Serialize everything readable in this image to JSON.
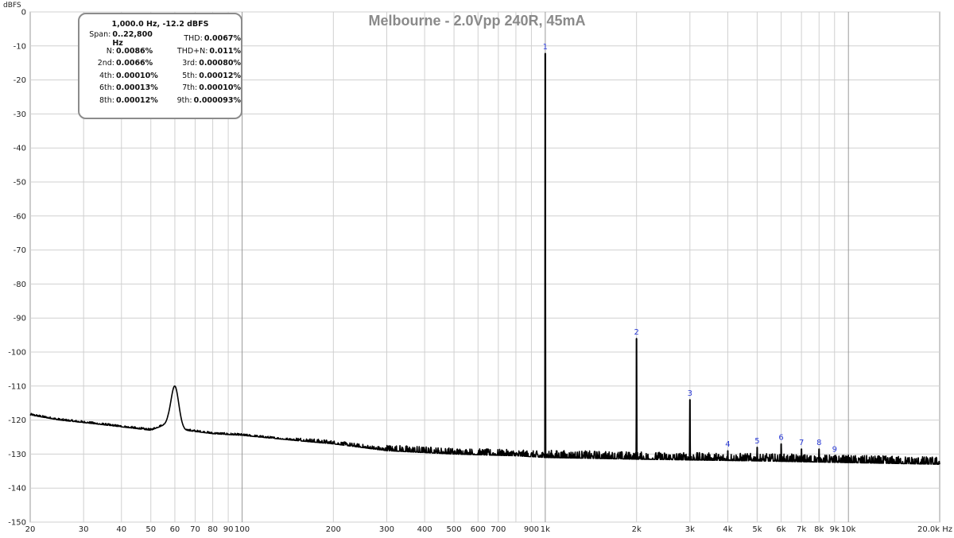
{
  "chart_data": {
    "type": "line",
    "title": "Melbourne - 2.0Vpp 240R, 45mA",
    "ylabel": "dBFS",
    "xlabel": "Hz",
    "xscale": "log",
    "xlim": [
      20,
      20000
    ],
    "ylim": [
      -150,
      0
    ],
    "grid": true,
    "legend": "none",
    "y_ticks": [
      "0",
      "-10",
      "-20",
      "-30",
      "-40",
      "-50",
      "-60",
      "-70",
      "-80",
      "-90",
      "-100",
      "-110",
      "-120",
      "-130",
      "-140",
      "-150"
    ],
    "x_ticks": [
      {
        "x": 20,
        "label": "20"
      },
      {
        "x": 30,
        "label": "30"
      },
      {
        "x": 40,
        "label": "40"
      },
      {
        "x": 50,
        "label": "50"
      },
      {
        "x": 60,
        "label": "60"
      },
      {
        "x": 70,
        "label": "70"
      },
      {
        "x": 80,
        "label": "80"
      },
      {
        "x": 90,
        "label": "90"
      },
      {
        "x": 100,
        "label": "100"
      },
      {
        "x": 200,
        "label": "200"
      },
      {
        "x": 300,
        "label": "300"
      },
      {
        "x": 400,
        "label": "400"
      },
      {
        "x": 500,
        "label": "500"
      },
      {
        "x": 600,
        "label": "600"
      },
      {
        "x": 700,
        "label": "700"
      },
      {
        "x": 900,
        "label": "900"
      },
      {
        "x": 1000,
        "label": "1k"
      },
      {
        "x": 2000,
        "label": "2k"
      },
      {
        "x": 3000,
        "label": "3k"
      },
      {
        "x": 4000,
        "label": "4k"
      },
      {
        "x": 5000,
        "label": "5k"
      },
      {
        "x": 6000,
        "label": "6k"
      },
      {
        "x": 7000,
        "label": "7k"
      },
      {
        "x": 8000,
        "label": "8k"
      },
      {
        "x": 9000,
        "label": "9k"
      },
      {
        "x": 10000,
        "label": "10k"
      },
      {
        "x": 20000,
        "label": "20.0k Hz"
      }
    ],
    "x_minor_grid": [
      30,
      40,
      50,
      60,
      70,
      80,
      90,
      200,
      300,
      400,
      500,
      600,
      700,
      800,
      900,
      2000,
      3000,
      4000,
      5000,
      6000,
      7000,
      8000,
      9000
    ],
    "x_major_grid": [
      100,
      1000,
      10000
    ],
    "series": [
      {
        "color": "#000000",
        "noise_floor": [
          [
            20,
            -118.5
          ],
          [
            25,
            -120
          ],
          [
            32,
            -121
          ],
          [
            40,
            -122
          ],
          [
            50,
            -123
          ],
          [
            57,
            -121
          ],
          [
            65,
            -123
          ],
          [
            80,
            -124
          ],
          [
            100,
            -124.5
          ],
          [
            150,
            -126
          ],
          [
            200,
            -127
          ],
          [
            300,
            -129
          ],
          [
            500,
            -130
          ],
          [
            800,
            -130.5
          ],
          [
            1000,
            -131
          ],
          [
            2000,
            -131.5
          ],
          [
            5000,
            -132
          ],
          [
            10000,
            -132.5
          ],
          [
            20000,
            -133
          ]
        ],
        "peaks": [
          {
            "x": 60,
            "y": -110,
            "kind": "hum"
          },
          {
            "x": 1000,
            "y": -12.2,
            "kind": "fundamental"
          },
          {
            "x": 2000,
            "y": -96,
            "kind": "harmonic"
          },
          {
            "x": 3000,
            "y": -114,
            "kind": "harmonic"
          },
          {
            "x": 4000,
            "y": -129,
            "kind": "harmonic"
          },
          {
            "x": 5000,
            "y": -128,
            "kind": "harmonic"
          },
          {
            "x": 6000,
            "y": -127,
            "kind": "harmonic"
          },
          {
            "x": 7000,
            "y": -128.5,
            "kind": "harmonic"
          },
          {
            "x": 8000,
            "y": -128.5,
            "kind": "harmonic"
          },
          {
            "x": 9000,
            "y": -130.5,
            "kind": "harmonic"
          }
        ]
      }
    ],
    "annotations": [
      {
        "label": "1",
        "x": 1000,
        "y": -12.2
      },
      {
        "label": "2",
        "x": 2000,
        "y": -96
      },
      {
        "label": "3",
        "x": 3000,
        "y": -114
      },
      {
        "label": "4",
        "x": 4000,
        "y": -129
      },
      {
        "label": "5",
        "x": 5000,
        "y": -128
      },
      {
        "label": "6",
        "x": 6000,
        "y": -127
      },
      {
        "label": "7",
        "x": 7000,
        "y": -128.5
      },
      {
        "label": "8",
        "x": 8000,
        "y": -128.5
      },
      {
        "label": "9",
        "x": 9000,
        "y": -130.5
      }
    ]
  },
  "info_box": {
    "header": "1,000.0 Hz, -12.2 dBFS",
    "rows": [
      {
        "l1": "Span:",
        "v1": "0..22,800 Hz",
        "l2": "THD:",
        "v2": "0.0067%"
      },
      {
        "l1": "N:",
        "v1": "0.0086%",
        "l2": "THD+N:",
        "v2": "0.011%"
      },
      {
        "l1": "2nd:",
        "v1": "0.0066%",
        "l2": "3rd:",
        "v2": "0.00080%"
      },
      {
        "l1": "4th:",
        "v1": "0.00010%",
        "l2": "5th:",
        "v2": "0.00012%"
      },
      {
        "l1": "6th:",
        "v1": "0.00013%",
        "l2": "7th:",
        "v2": "0.00010%"
      },
      {
        "l1": "8th:",
        "v1": "0.00012%",
        "l2": "9th:",
        "v2": "0.000093%"
      }
    ]
  }
}
